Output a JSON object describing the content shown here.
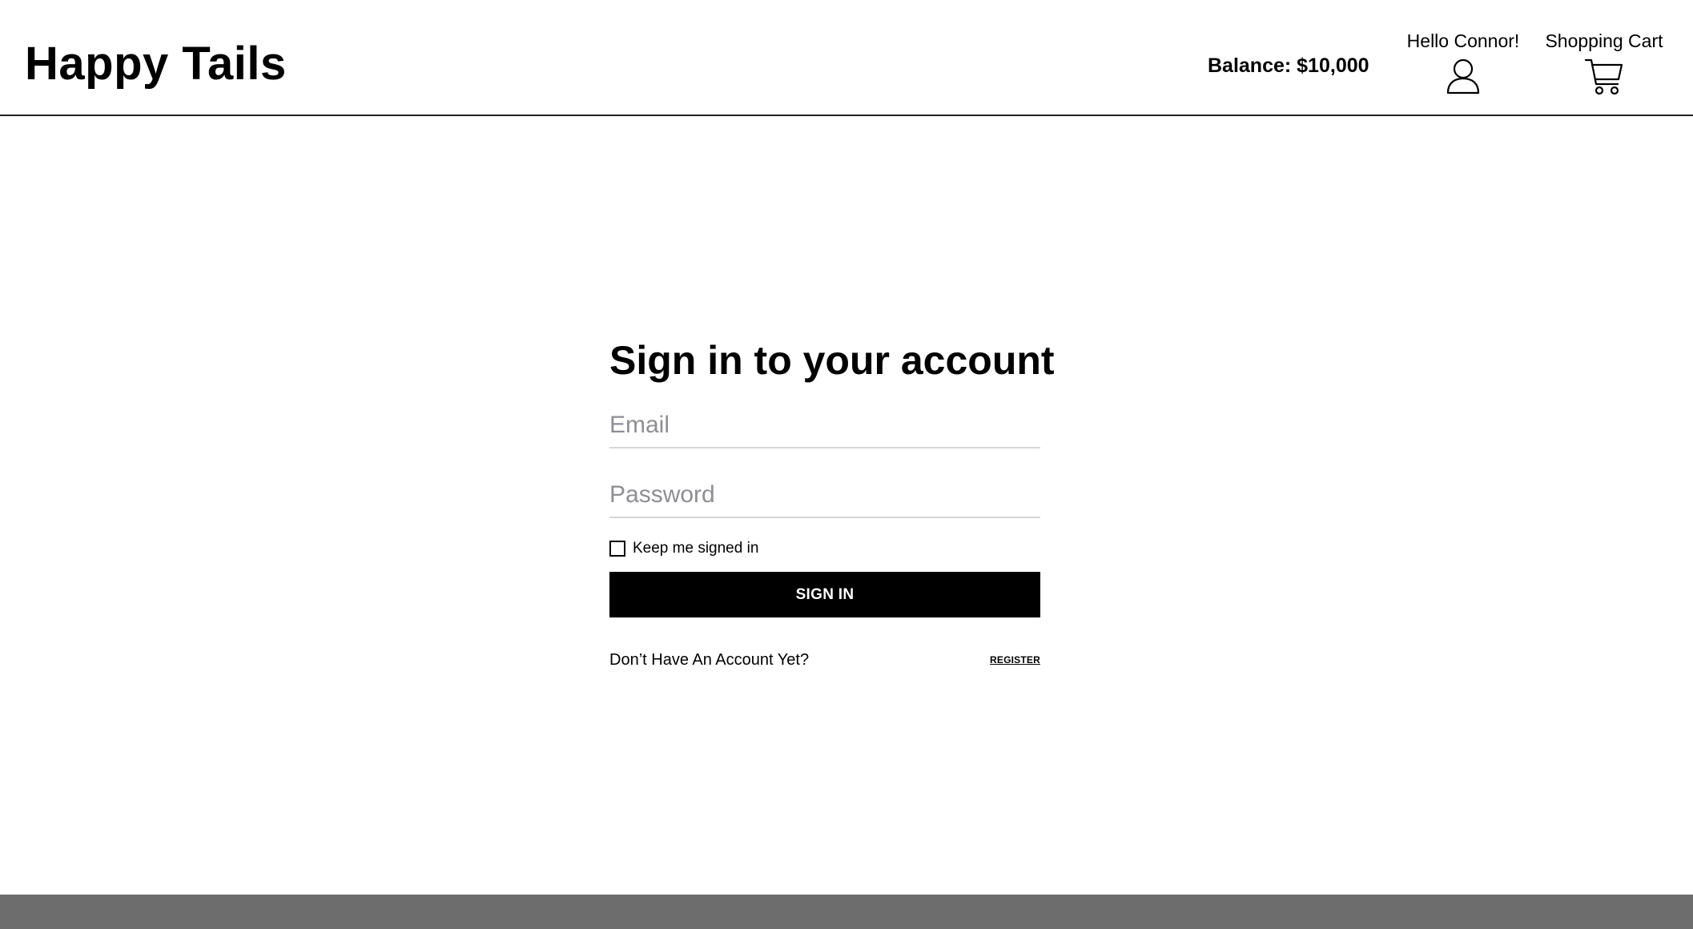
{
  "header": {
    "brand": "Happy Tails",
    "balance": "Balance: $10,000",
    "greeting": "Hello Connor!",
    "cart_label": "Shopping Cart",
    "user_icon": "user-icon",
    "cart_icon": "shopping-cart-icon"
  },
  "signin": {
    "title": "Sign in to your account",
    "email_placeholder": "Email",
    "email_value": "",
    "password_placeholder": "Password",
    "password_value": "",
    "keep_signed_in_label": "Keep me signed in",
    "keep_signed_in_checked": false,
    "submit_label": "SIGN IN",
    "no_account_text": "Don’t Have An Account Yet?",
    "register_label": "REGISTER"
  },
  "colors": {
    "primary_button": "#000000",
    "footer": "#6d6d6d",
    "placeholder": "#8e8e93"
  }
}
